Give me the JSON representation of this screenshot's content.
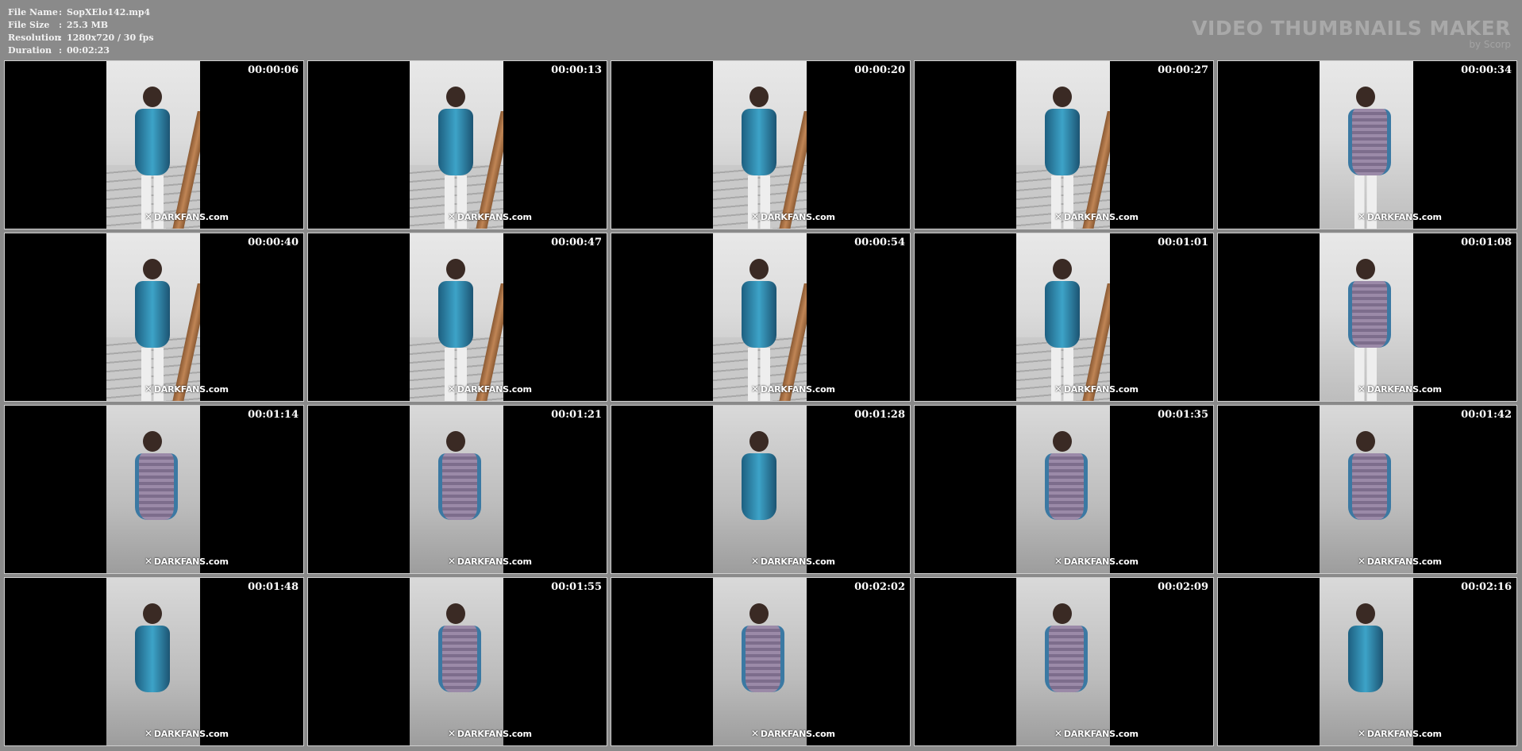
{
  "info": [
    {
      "key": "File Name",
      "value": "SopXElo142.mp4"
    },
    {
      "key": "File Size",
      "value": "25.3 MB"
    },
    {
      "key": "Resolution",
      "value": "1280x720 / 30 fps"
    },
    {
      "key": "Duration",
      "value": "00:02:23"
    }
  ],
  "info_sep": ":",
  "brand": {
    "name": "VIDEO THUMBNAILS MAKER",
    "by": "by Scorp"
  },
  "watermark": "DARKFANS.com",
  "watermark_icon": "mask-logo-icon",
  "thumbnails": [
    {
      "time": "00:00:06",
      "dress": "blue",
      "scene": "stairs"
    },
    {
      "time": "00:00:13",
      "dress": "blue",
      "scene": "stairs"
    },
    {
      "time": "00:00:20",
      "dress": "blue",
      "scene": "stairs"
    },
    {
      "time": "00:00:27",
      "dress": "blue",
      "scene": "stairs"
    },
    {
      "time": "00:00:34",
      "dress": "purple",
      "scene": "wall"
    },
    {
      "time": "00:00:40",
      "dress": "blue",
      "scene": "stairs"
    },
    {
      "time": "00:00:47",
      "dress": "blue",
      "scene": "stairs"
    },
    {
      "time": "00:00:54",
      "dress": "blue",
      "scene": "stairs"
    },
    {
      "time": "00:01:01",
      "dress": "blue",
      "scene": "stairs"
    },
    {
      "time": "00:01:08",
      "dress": "purple",
      "scene": "wall"
    },
    {
      "time": "00:01:14",
      "dress": "purple",
      "scene": "room"
    },
    {
      "time": "00:01:21",
      "dress": "purple",
      "scene": "room"
    },
    {
      "time": "00:01:28",
      "dress": "blue",
      "scene": "room"
    },
    {
      "time": "00:01:35",
      "dress": "purple",
      "scene": "room"
    },
    {
      "time": "00:01:42",
      "dress": "purple",
      "scene": "room"
    },
    {
      "time": "00:01:48",
      "dress": "blue",
      "scene": "room"
    },
    {
      "time": "00:01:55",
      "dress": "purple",
      "scene": "room"
    },
    {
      "time": "00:02:02",
      "dress": "purple",
      "scene": "room"
    },
    {
      "time": "00:02:09",
      "dress": "purple",
      "scene": "room"
    },
    {
      "time": "00:02:16",
      "dress": "blue",
      "scene": "room"
    }
  ]
}
